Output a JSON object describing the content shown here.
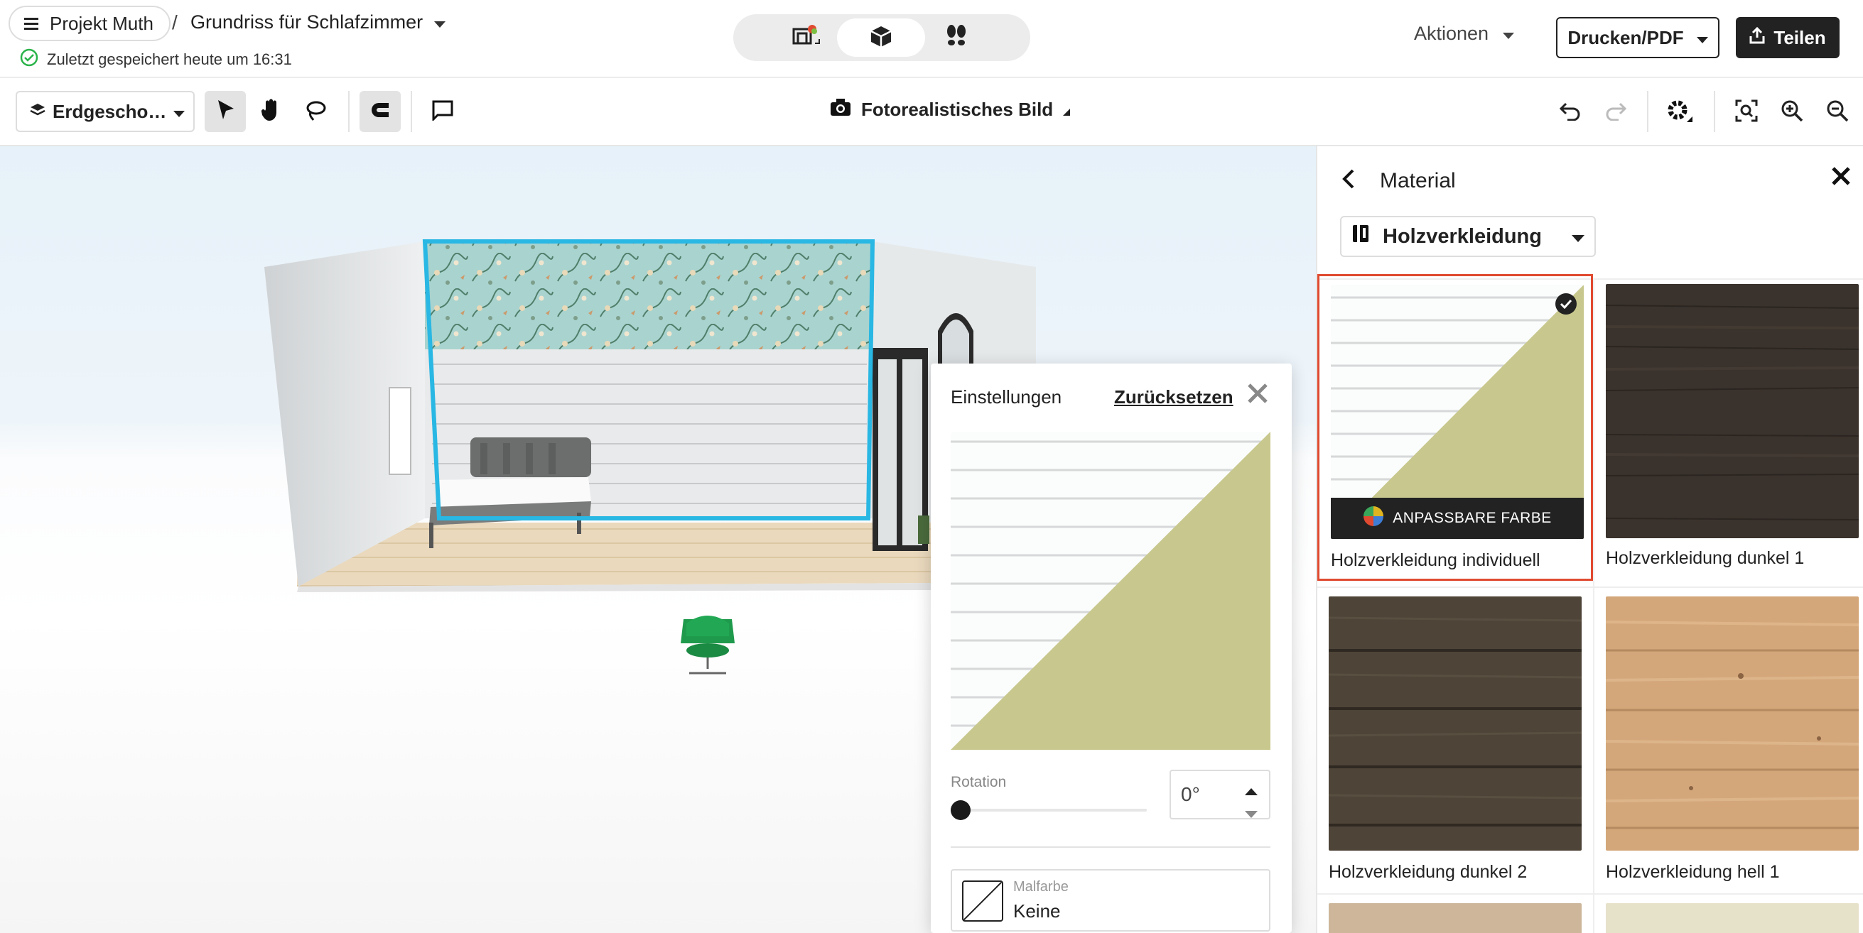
{
  "header": {
    "menu_project_label": "Projekt Muth",
    "separator": "/",
    "document_title": "Grundriss für Schlafzimmer",
    "saved_status": "Zuletzt gespeichert heute um 16:31",
    "actions_label": "Aktionen",
    "print_label": "Drucken/PDF",
    "share_label": "Teilen"
  },
  "view_modes": [
    "2d-plan",
    "3d-view",
    "walkthrough"
  ],
  "toolbar": {
    "floor_label": "Erdgescho…",
    "photo_label": "Fotorealistisches Bild"
  },
  "settings": {
    "title": "Einstellungen",
    "reset_label": "Zurücksetzen",
    "rotation_label": "Rotation",
    "rotation_value": "0°",
    "paint_label": "Malfarbe",
    "paint_value": "Keine"
  },
  "panel": {
    "title": "Material",
    "category": "Holzverkleidung",
    "materials": [
      {
        "name": "Holzverkleidung individuell",
        "badge": "ANPASSBARE FARBE",
        "selected": true
      },
      {
        "name": "Holzverkleidung dunkel 1"
      },
      {
        "name": "Holzverkleidung dunkel 2"
      },
      {
        "name": "Holzverkleidung hell 1"
      }
    ]
  },
  "colors": {
    "accent_selection": "#e04a30",
    "wall_highlight": "#29b7e3",
    "custom_color": "#c8c88e",
    "dark_button": "#222222",
    "saved_ok": "#2ab34a"
  }
}
